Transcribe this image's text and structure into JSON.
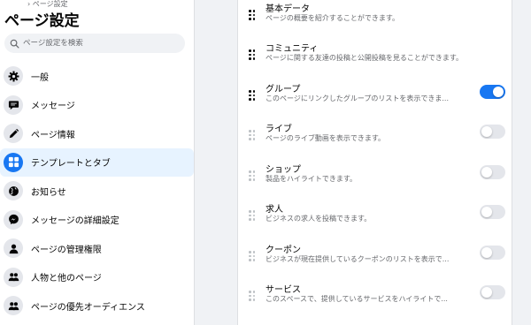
{
  "colors": {
    "accent": "#1877f2",
    "toggle_off": "#e4e6eb",
    "drag_active": "#050505",
    "drag_inactive": "#bcc0c4"
  },
  "sidebar": {
    "breadcrumb": "› ページ設定",
    "title": "ページ設定",
    "search_placeholder": "ページ設定を検索",
    "items": [
      {
        "label": "一般",
        "icon": "gear-icon",
        "active": false
      },
      {
        "label": "メッセージ",
        "icon": "message-bubble-icon",
        "active": false
      },
      {
        "label": "ページ情報",
        "icon": "pencil-icon",
        "active": false
      },
      {
        "label": "テンプレートとタブ",
        "icon": "grid-icon",
        "active": true
      },
      {
        "label": "お知らせ",
        "icon": "globe-icon",
        "active": false
      },
      {
        "label": "メッセージの詳細設定",
        "icon": "messenger-icon",
        "active": false
      },
      {
        "label": "ページの管理権限",
        "icon": "person-icon",
        "active": false
      },
      {
        "label": "人物と他のページ",
        "icon": "people-icon",
        "active": false
      },
      {
        "label": "ページの優先オーディエンス",
        "icon": "people-icon",
        "active": false
      }
    ]
  },
  "tabs": [
    {
      "title": "基本データ",
      "desc": "ページの概要を紹介することができます。",
      "draggable": true,
      "toggle": null
    },
    {
      "title": "コミュニティ",
      "desc": "ページに関する友達の投稿と公開投稿を見ることができます。",
      "draggable": true,
      "toggle": null
    },
    {
      "title": "グループ",
      "desc": "このページにリンクしたグループのリストを表示できま...",
      "draggable": true,
      "toggle": true
    },
    {
      "title": "ライブ",
      "desc": "ページのライブ動画を表示できます。",
      "draggable": false,
      "toggle": false
    },
    {
      "title": "ショップ",
      "desc": "製品をハイライトできます。",
      "draggable": false,
      "toggle": false
    },
    {
      "title": "求人",
      "desc": "ビジネスの求人を投稿できます。",
      "draggable": false,
      "toggle": false
    },
    {
      "title": "クーポン",
      "desc": "ビジネスが現在提供しているクーポンのリストを表示で...",
      "draggable": false,
      "toggle": false
    },
    {
      "title": "サービス",
      "desc": "このスペースで、提供しているサービスをハイライトで...",
      "draggable": false,
      "toggle": false
    }
  ]
}
